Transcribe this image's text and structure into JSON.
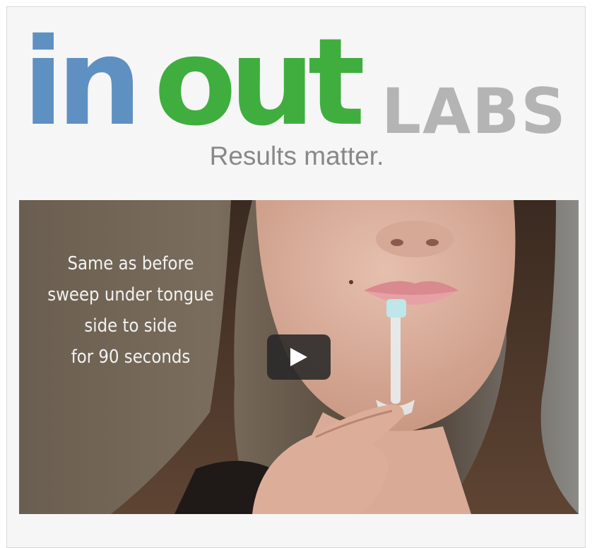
{
  "logo": {
    "part_in": "in",
    "part_out": "out",
    "part_labs": "LABS",
    "colors": {
      "in": "#5f90c2",
      "out": "#3fae3f",
      "labs": "#b4b4b4"
    }
  },
  "tagline": "Results matter.",
  "video": {
    "caption_lines": [
      "Same as before",
      "sweep under tongue",
      "side to side",
      "for 90 seconds"
    ],
    "play_icon": "play-icon"
  }
}
